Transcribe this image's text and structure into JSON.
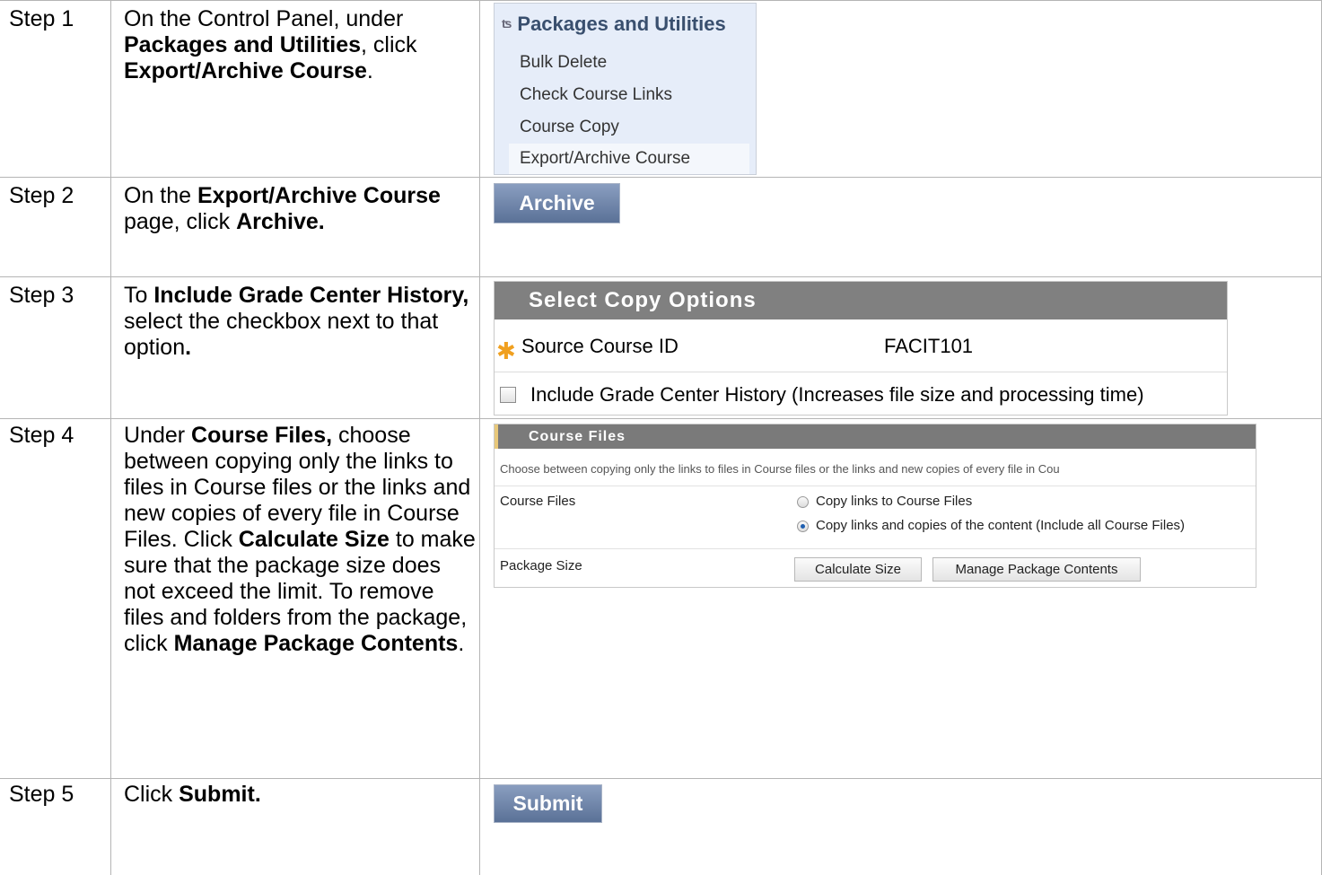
{
  "steps": [
    {
      "label": "Step 1"
    },
    {
      "label": "Step 2"
    },
    {
      "label": "Step 3"
    },
    {
      "label": "Step 4"
    },
    {
      "label": "Step 5"
    }
  ],
  "instructions": {
    "step1": {
      "t1": "On the Control Panel, under ",
      "b1": "Packages and Utilities",
      "t2": ", click ",
      "b2": "Export/Archive Course",
      "t3": "."
    },
    "step2": {
      "t1": "On the ",
      "b1": "Export/Archive Course",
      "t2": " page, click ",
      "b2": "Archive."
    },
    "step3": {
      "t1": "To ",
      "b1": "Include Grade Center History,",
      "t2": " select the checkbox next to that option",
      "b2": "."
    },
    "step4": {
      "t1": "Under ",
      "b1": "Course Files,",
      "t2": " choose between copying only the links to files in Course files or the links and new copies of every file in Course Files. Click ",
      "b2": "Calculate Size",
      "t3": " to make sure that the package size does not exceed the limit. To remove files and folders from the package, click ",
      "b3": "Manage Package Contents",
      "t4": "."
    },
    "step5": {
      "t1": "Click ",
      "b1": "Submit."
    }
  },
  "menu": {
    "title": "Packages and Utilities",
    "items": [
      "Bulk Delete",
      "Check Course Links",
      "Course Copy",
      "Export/Archive Course"
    ]
  },
  "archive_button": "Archive",
  "copy_options": {
    "header": "Select Copy Options",
    "source_label": "Source Course ID",
    "source_value": "FACIT101",
    "history_label": "Include Grade Center History (Increases file size and processing time)"
  },
  "course_files": {
    "header": "Course Files",
    "description": "Choose between copying only the links to files in Course files or the links and new copies of every file in Cou",
    "field_label": "Course Files",
    "option1": "Copy links to Course Files",
    "option2": "Copy links and copies of the content (Include all Course Files)",
    "size_label": "Package Size",
    "calc_button": "Calculate Size",
    "manage_button": "Manage Package Contents"
  },
  "submit_button": "Submit"
}
